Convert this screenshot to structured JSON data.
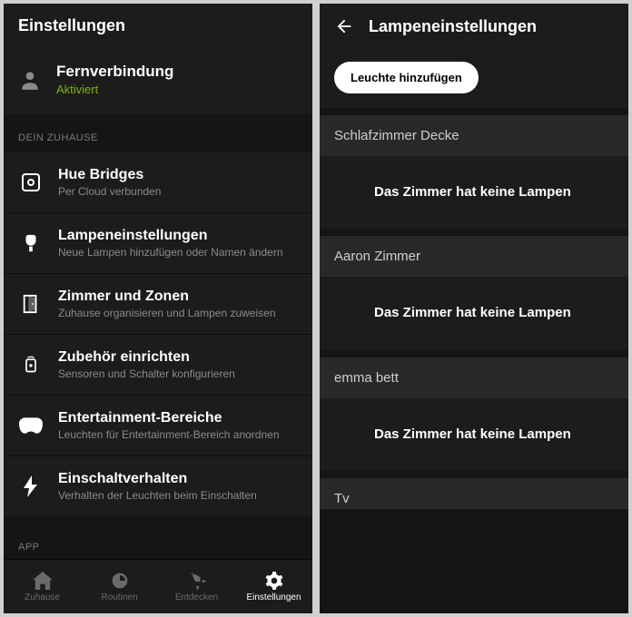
{
  "left": {
    "header": "Einstellungen",
    "remote": {
      "title": "Fernverbindung",
      "status": "Aktiviert"
    },
    "section1": "DEIN ZUHAUSE",
    "items": [
      {
        "title": "Hue Bridges",
        "sub": "Per Cloud verbunden",
        "subClass": "orange"
      },
      {
        "title": "Lampeneinstellungen",
        "sub": "Neue Lampen hinzufügen oder Namen ändern"
      },
      {
        "title": "Zimmer und Zonen",
        "sub": "Zuhause organisieren und Lampen zuweisen"
      },
      {
        "title": "Zubehör einrichten",
        "sub": "Sensoren und Schalter konfigurieren"
      },
      {
        "title": "Entertainment-Bereiche",
        "sub": "Leuchten für Entertainment-Bereich anordnen"
      },
      {
        "title": "Einschaltverhalten",
        "sub": "Verhalten der Leuchten beim Einschalten"
      }
    ],
    "section2": "APP",
    "nav": [
      "Zuhause",
      "Routinen",
      "Entdecken",
      "Einstellungen"
    ]
  },
  "right": {
    "header": "Lampeneinstellungen",
    "addBtn": "Leuchte hinzufügen",
    "rooms": [
      {
        "name": "Schlafzimmer Decke",
        "empty": "Das Zimmer hat keine Lampen"
      },
      {
        "name": "Aaron Zimmer",
        "empty": "Das Zimmer hat keine Lampen"
      },
      {
        "name": "emma bett",
        "empty": "Das Zimmer hat keine Lampen"
      },
      {
        "name": "Tv"
      }
    ]
  }
}
